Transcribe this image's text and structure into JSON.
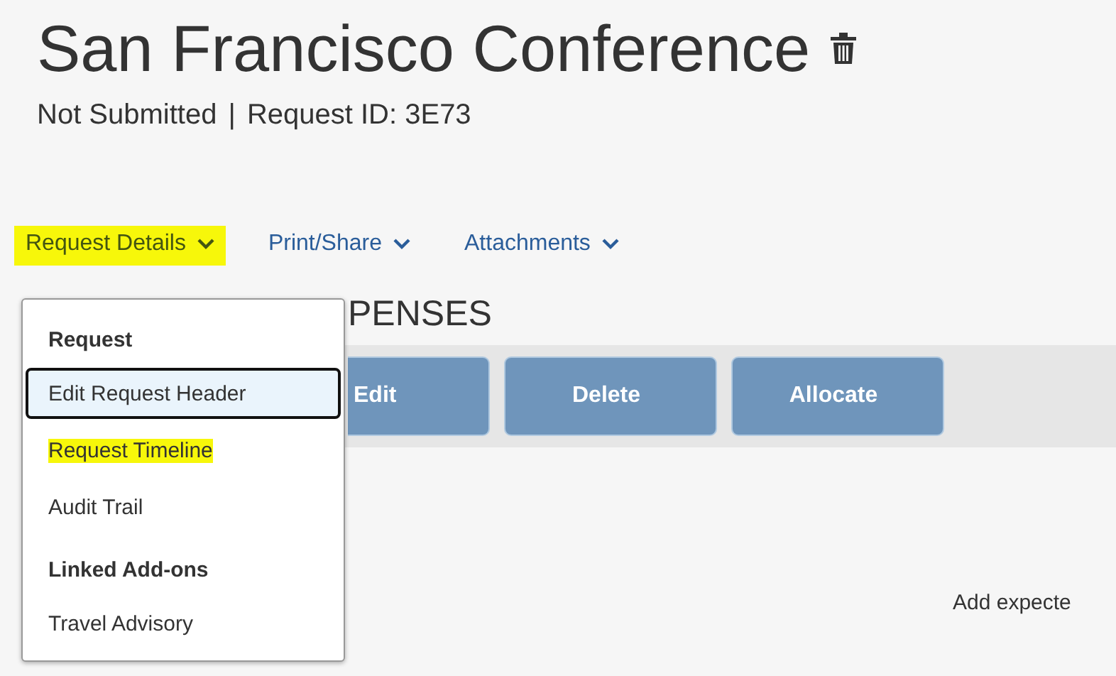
{
  "title": "San Francisco Conference",
  "status": "Not Submitted",
  "separator": "|",
  "request_id": "Request ID: 3E73",
  "nav": [
    {
      "label": "Request Details",
      "highlighted": true
    },
    {
      "label": "Print/Share",
      "highlighted": false
    },
    {
      "label": "Attachments",
      "highlighted": false
    }
  ],
  "section_heading": "PENSES",
  "toolbar_buttons": [
    {
      "label": "Edit",
      "covered": true
    },
    {
      "label": "Delete",
      "covered": false
    },
    {
      "label": "Allocate",
      "covered": false
    }
  ],
  "empty_hint": "Add expecte",
  "menu": [
    {
      "kind": "header",
      "label": "Request"
    },
    {
      "kind": "item",
      "label": "Edit Request Header",
      "focused": true,
      "highlighted": false
    },
    {
      "kind": "item",
      "label": "Request Timeline",
      "focused": false,
      "highlighted": true
    },
    {
      "kind": "item",
      "label": "Audit Trail",
      "focused": false,
      "highlighted": false
    },
    {
      "kind": "header",
      "label": "Linked Add-ons"
    },
    {
      "kind": "item",
      "label": "Travel Advisory",
      "focused": false,
      "highlighted": false
    }
  ]
}
